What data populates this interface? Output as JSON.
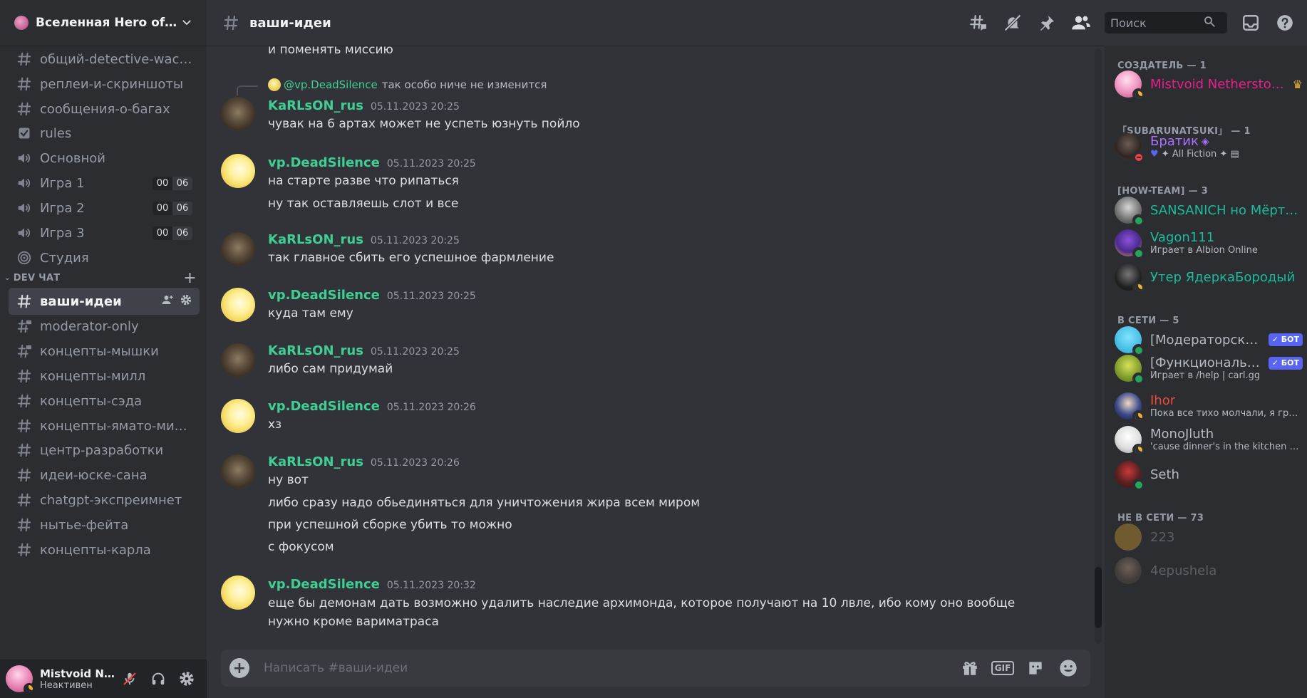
{
  "server": {
    "name": "Вселенная Hero of ..."
  },
  "channels": [
    {
      "name": "общий-detective-wacra...",
      "type": "text"
    },
    {
      "name": "реплеи-и-скриншоты",
      "type": "text"
    },
    {
      "name": "сообщения-о-багах",
      "type": "text"
    },
    {
      "name": "rules",
      "type": "rules"
    },
    {
      "name": "Основной",
      "type": "voice"
    },
    {
      "name": "Игра 1",
      "type": "voice",
      "c1": "00",
      "c2": "06"
    },
    {
      "name": "Игра 2",
      "type": "voice",
      "c1": "00",
      "c2": "06"
    },
    {
      "name": "Игра 3",
      "type": "voice",
      "c1": "00",
      "c2": "06"
    },
    {
      "name": "Студия",
      "type": "stage"
    }
  ],
  "category": {
    "name": "DEV ЧАТ",
    "plus": "+"
  },
  "dev_channels": [
    {
      "name": "ваши-идеи",
      "type": "text",
      "active": true
    },
    {
      "name": "moderator-only",
      "type": "locked"
    },
    {
      "name": "концепты-мышки",
      "type": "locked"
    },
    {
      "name": "концепты-милл",
      "type": "text"
    },
    {
      "name": "концепты-сэда",
      "type": "text"
    },
    {
      "name": "концепты-ямато-миши",
      "type": "text"
    },
    {
      "name": "центр-разработки",
      "type": "text"
    },
    {
      "name": "идеи-юске-сана",
      "type": "text"
    },
    {
      "name": "chatgpt-экспреимнет",
      "type": "text"
    },
    {
      "name": "нытье-фейта",
      "type": "text"
    },
    {
      "name": "концепты-карла",
      "type": "text"
    }
  ],
  "user": {
    "name": "Mistvoid N...",
    "status": "Неактивен"
  },
  "header": {
    "channel": "ваши-идеи",
    "search_placeholder": "Поиск"
  },
  "chat": {
    "top_line": "и поменять миссию",
    "reply": {
      "name": "@vp.DeadSilence",
      "text": "так особо ниче не изменится"
    },
    "groups": [
      {
        "author": "KaRLsON_rus",
        "time": "05.11.2023 20:25",
        "lines": [
          "чувак на 6 артах может не успеть юзнуть пойло"
        ]
      },
      {
        "author": "vp.DeadSilence",
        "time": "05.11.2023 20:25",
        "lines": [
          "на старте разве что рипаться",
          "ну так оставляешь слот и все"
        ]
      },
      {
        "author": "KaRLsON_rus",
        "time": "05.11.2023 20:25",
        "lines": [
          "так главное сбить его успешное фармление"
        ]
      },
      {
        "author": "vp.DeadSilence",
        "time": "05.11.2023 20:25",
        "lines": [
          "куда там ему"
        ]
      },
      {
        "author": "KaRLsON_rus",
        "time": "05.11.2023 20:25",
        "lines": [
          "либо сам придумай"
        ]
      },
      {
        "author": "vp.DeadSilence",
        "time": "05.11.2023 20:26",
        "lines": [
          "хз"
        ]
      },
      {
        "author": "KaRLsON_rus",
        "time": "05.11.2023 20:26",
        "lines": [
          "ну вот",
          "либо сразу надо обьединяться для уничтожения жира всем миром",
          "при успешной сборке убить то можно",
          "с фокусом"
        ]
      },
      {
        "author": "vp.DeadSilence",
        "time": "05.11.2023 20:32",
        "lines": [
          "еще бы демонам дать возможно удалить наследие архимонда, которое получают на 10 лвле, ибо кому оно вообще нужно кроме вариматраса"
        ]
      }
    ]
  },
  "composer": {
    "placeholder": "Написать #ваши-идеи",
    "gif": "GIF"
  },
  "members": {
    "sections": [
      {
        "title": "СОЗДАТЕЛЬ — 1"
      },
      {
        "title": "「SUBARUNATSUKI」 — 1"
      },
      {
        "title": "[HOW-TEAM] — 3"
      },
      {
        "title": "В СЕТИ — 5"
      },
      {
        "title": "НЕ В СЕТИ — 73"
      }
    ],
    "list": [
      {
        "name": "Mistvoid Netherstorm",
        "color": "#e91e8c",
        "activity": ""
      },
      {
        "name": "Братик",
        "color": "#a970ff",
        "activity": "All Fiction"
      },
      {
        "name": "SANSANICH но Мёртвый",
        "color": "#1abc9c",
        "activity": ""
      },
      {
        "name": "Vagon111",
        "color": "#1abc9c",
        "activity": "Играет в Albion Online"
      },
      {
        "name": "Утер ЯдеркаБородый",
        "color": "#1abc9c",
        "activity": ""
      },
      {
        "name": "[Модераторский бот]",
        "color": "#b5bac1",
        "activity": "",
        "bot": "✓ БОТ"
      },
      {
        "name": "[Функциональный бот]",
        "color": "#b5bac1",
        "activity": "Играет в /help | carl.gg",
        "bot": "✓ БОТ"
      },
      {
        "name": "Ihor",
        "color": "#e74c3c",
        "activity": "Пока все тихо молчали, я громко..."
      },
      {
        "name": "MonoJluth",
        "color": "#b5bac1",
        "activity": "'cause dinner's in the kitchen and..."
      },
      {
        "name": "Seth",
        "color": "#b5bac1",
        "activity": ""
      },
      {
        "name": "223",
        "color": "#b5bac1",
        "activity": ""
      },
      {
        "name": "4epushela",
        "color": "#b5bac1",
        "activity": ""
      }
    ]
  }
}
